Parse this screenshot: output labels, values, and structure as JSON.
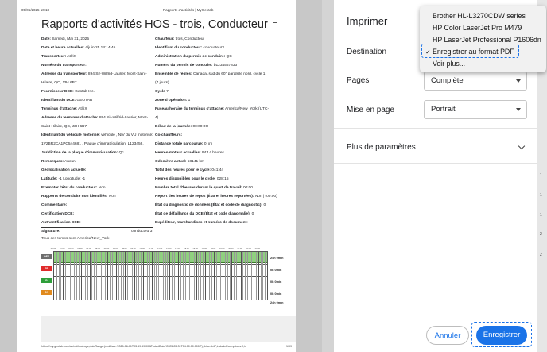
{
  "page_header": {
    "datetime": "05/06/2025 10:18",
    "center": "Rapports d'activités | MyGeotab"
  },
  "report": {
    "title": "Rapports d'activités HOS - trois, Conducteur",
    "left_fields": [
      [
        "Date:",
        " Samedi, Mai 31, 2025"
      ],
      [
        "Date et heure actuelles:",
        " 4/juin/25 14:14:45"
      ],
      [
        "Transporteur:",
        " AtlriX"
      ],
      [
        "Numéro du transporteur:",
        ""
      ],
      [
        "Adresse du transporteur:",
        " 894 Sir-Wilfrid-Laurier, Mont-Saint-"
      ],
      [
        "",
        "Hilaire, QC, J3H 6B7"
      ],
      [
        "Fournisseur DCE:",
        " Geotab Inc."
      ],
      [
        "Identifiant du DCE:",
        " GEOTAB"
      ],
      [
        "Terminus d'attache:",
        " AtlriX"
      ],
      [
        "Adresse du terminus d'attache:",
        " 894 Sir-Wilfrid-Laurier, Mont-"
      ],
      [
        "",
        "Saint-Hilaire, QC, J3H 6B7"
      ],
      [
        "Identifiant du véhicule motorisé:",
        " vehicule , NIV du VU motorisé:"
      ],
      [
        "",
        "1V2BR2CA1PC544681 , Plaque d'immatriculation: L123456,"
      ],
      [
        "Juridiction de la plaque d'immatriculation:",
        " Qc"
      ],
      [
        "Remorques:",
        " Aucun"
      ],
      [
        "Géolocalisation actuelle:",
        ""
      ],
      [
        "Latitude:",
        " -1 Longitude: -1"
      ],
      [
        "Exempter l'état du conducteur:",
        " Non"
      ],
      [
        "Rapports de conduite non identifiés:",
        " Non"
      ],
      [
        "Commentaire:",
        ""
      ],
      [
        "Certification DCE:",
        ""
      ],
      [
        "Authentification DCE:",
        ""
      ],
      [
        "Signature:",
        ""
      ]
    ],
    "right_fields": [
      [
        "Chauffeur:",
        " trois, Conducteur"
      ],
      [
        "Identifiant du conducteur:",
        " conducteur3"
      ],
      [
        "Administration du permis de conduire:",
        " QC"
      ],
      [
        "Numéro du permis de conduire:",
        " b1234567833"
      ],
      [
        "Ensemble de règles:",
        " Canada, sud du 60° parallèle nord, cycle 1"
      ],
      [
        "",
        "(7 jours)"
      ],
      [
        "Cycle",
        " 7"
      ],
      [
        "Zone d'opération:",
        " 1"
      ],
      [
        "Fuseau horaire du terminus d'attache:",
        " America/New_York (UTC-"
      ],
      [
        "",
        "4)"
      ],
      [
        "Début de la journée:",
        " 00:00:00"
      ],
      [
        "Co-chauffeurs:",
        ""
      ],
      [
        "Distance totale parcourue:",
        " 0 km"
      ],
      [
        "Heures-moteur actuelles:",
        " 941.4 heures"
      ],
      [
        "Odomètre actuel:",
        " 58141 km"
      ],
      [
        "Total des heures pour le cycle:",
        " 041:44"
      ],
      [
        "Heures disponibles pour le cycle:",
        " 028:15"
      ],
      [
        "Nombre total d'heures durant le quart de travail:",
        " 00:00"
      ],
      [
        "Report des heures de repos (État et heures reportées):",
        " Non | (00:00)"
      ],
      [
        "État du diagnostic de données (État et code de diagnostic):",
        " 0"
      ],
      [
        "État de défaillance du DCE (État et code d'anomalie):",
        " 0"
      ],
      [
        "Expéditeur, marchandises et numéro de document:",
        ""
      ]
    ],
    "signature_name": "conducteur3",
    "timezone_note": "Tous ces temps sont America/New_York",
    "graph": {
      "hour_labels": [
        "00:00",
        "01:00",
        "02:00",
        "03:00",
        "04:00",
        "05:00",
        "06:00",
        "07:00",
        "08:00",
        "09:00",
        "10:00",
        "11:00",
        "12:00",
        "13:00",
        "14:00",
        "15:00",
        "16:00",
        "17:00",
        "18:00",
        "19:00",
        "20:00",
        "21:00",
        "22:00",
        "23:00"
      ],
      "rows": [
        {
          "label": "OFF",
          "color": "#6e6e6e",
          "total": "24h 0min"
        },
        {
          "label": "SB",
          "color": "#e02b2b",
          "total": "0h 0min"
        },
        {
          "label": "D",
          "color": "#2e9e3a",
          "total": "0h 0min"
        },
        {
          "label": "ON",
          "color": "#e08a1e",
          "total": "0h 0min"
        }
      ],
      "grand_total": "24h 0min"
    },
    "footer_url": "https://my.geotab.com/atrix/#hosLogs,dateRange:(endDate:'2025-06-01T03:59:59.000Z',startDate:'2025-05-31T04:00:00.000Z'),driver:b47,includeExemptions:!f,in",
    "footer_page": "1/99"
  },
  "print_panel": {
    "title": "Imprimer",
    "destination_label": "Destination",
    "pages_label": "Pages",
    "pages_value": "Complète",
    "layout_label": "Mise en page",
    "layout_value": "Portrait",
    "more_settings": "Plus de paramètres",
    "cancel_label": "Annuler",
    "save_label": "Enregistrer"
  },
  "destination_dropdown": {
    "items": [
      "Brother HL-L3270CDW series",
      "HP Color LaserJet Pro M479",
      "HP LaserJet Professional P1606dn",
      "Enregistrer au format PDF",
      "Voir plus..."
    ],
    "selected_index": 3,
    "check_glyph": "✓"
  },
  "side_strip": {
    "marks": [
      "1",
      "1",
      "1",
      "2",
      "2"
    ]
  },
  "colors": {
    "accent": "#1a73e8",
    "off_duty_fill": "#8fd07f"
  }
}
